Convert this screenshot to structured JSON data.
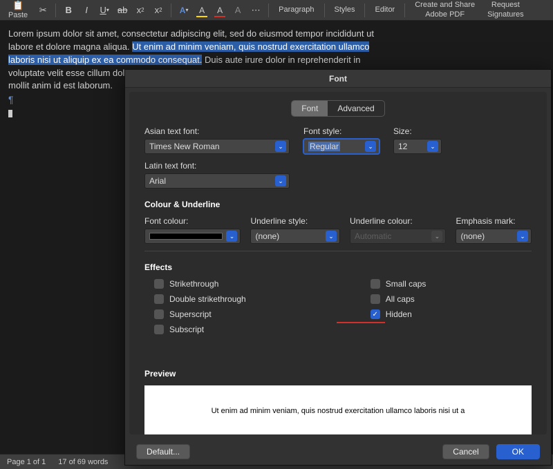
{
  "toolbar": {
    "paste": "Paste",
    "paragraph": "Paragraph",
    "styles": "Styles",
    "editor": "Editor",
    "create_share_line1": "Create and Share",
    "create_share_line2": "Adobe PDF",
    "request_sig_line1": "Request",
    "request_sig_line2": "Signatures"
  },
  "doc": {
    "pre": "Lorem ipsum dolor sit amet, consectetur adipiscing elit, sed do eiusmod tempor incididunt ut labore et dolore magna aliqua. ",
    "sel": "Ut enim ad minim veniam, quis nostrud exercitation ullamco laboris nisi ut aliquip ex ea commodo consequat.",
    "post": " Duis aute irure dolor in reprehenderit in voluptate velit esse cillum dolore eu fugiat nulla pariatur. Excepteur sint occaecat cu",
    "post2": "mollit anim id est laborum."
  },
  "status": {
    "page": "Page 1 of 1",
    "words": "17 of 69 words"
  },
  "dialog": {
    "title": "Font",
    "tabs": {
      "font": "Font",
      "advanced": "Advanced"
    },
    "labels": {
      "asian": "Asian text font:",
      "latin": "Latin text font:",
      "style": "Font style:",
      "size": "Size:",
      "colour_underline": "Colour & Underline",
      "font_colour": "Font colour:",
      "underline_style": "Underline style:",
      "underline_colour": "Underline colour:",
      "emphasis": "Emphasis mark:",
      "effects": "Effects",
      "preview": "Preview"
    },
    "values": {
      "asian": "Times New Roman",
      "latin": "Arial",
      "style": "Regular",
      "size": "12",
      "underline_style": "(none)",
      "underline_colour": "Automatic",
      "emphasis": "(none)"
    },
    "effects": {
      "strike": "Strikethrough",
      "dstrike": "Double strikethrough",
      "sup": "Superscript",
      "sub": "Subscript",
      "smallcaps": "Small caps",
      "allcaps": "All caps",
      "hidden": "Hidden"
    },
    "preview_text": "Ut enim ad minim veniam, quis nostrud exercitation ullamco laboris nisi ut a",
    "buttons": {
      "default": "Default...",
      "cancel": "Cancel",
      "ok": "OK"
    }
  }
}
